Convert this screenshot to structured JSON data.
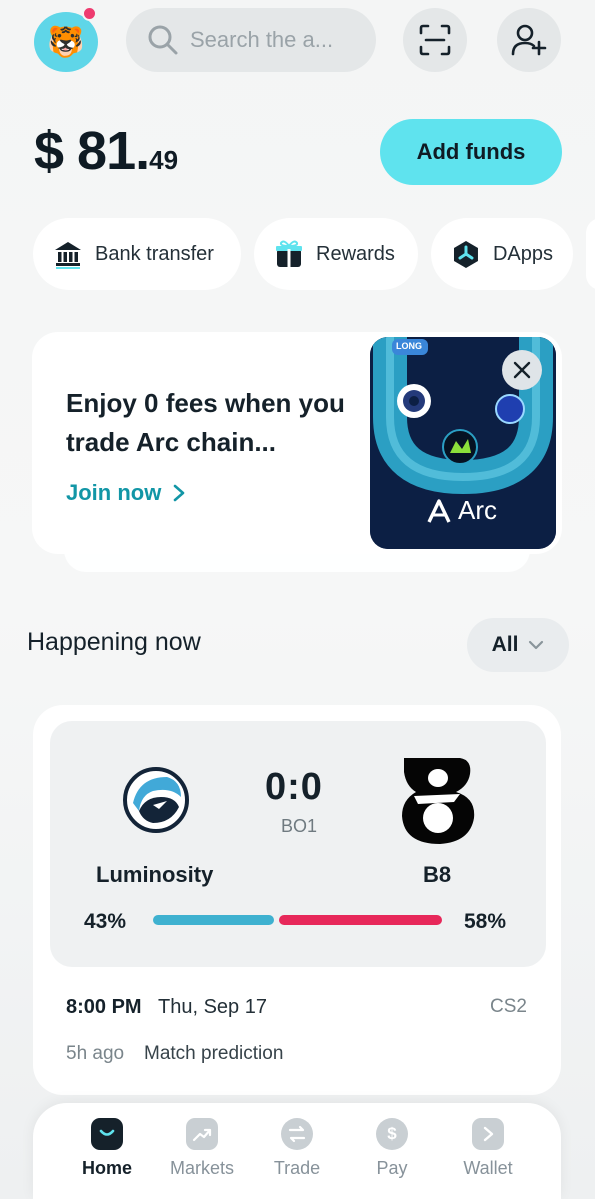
{
  "header": {
    "avatar_emoji": "🐯",
    "search_placeholder": "Search the a...",
    "scan_icon": "scan-icon",
    "add_contact_icon": "add-user-icon"
  },
  "balance": {
    "main": "$ 81.",
    "cents": "49"
  },
  "add_funds_label": "Add funds",
  "quick_actions": [
    {
      "label": "Bank transfer",
      "icon": "bank-icon"
    },
    {
      "label": "Rewards",
      "icon": "gift-icon"
    },
    {
      "label": "DApps",
      "icon": "dapps-icon"
    }
  ],
  "promo": {
    "title": "Enjoy 0 fees when you trade Arc chain...",
    "link": "Join now",
    "brand": "Arc",
    "badge": "LONG"
  },
  "happening": {
    "title": "Happening now",
    "filter": "All"
  },
  "match": {
    "team_a": "Luminosity",
    "team_b": "B8",
    "score": "0:0",
    "format": "BO1",
    "pct_a": "43%",
    "pct_b": "58%",
    "share_a": 0.43,
    "share_b": 0.58,
    "time": "8:00 PM",
    "date": "Thu, Sep 17",
    "game": "CS2",
    "ago": "5h ago",
    "type": "Match prediction"
  },
  "colors": {
    "accent": "#5fe3ee",
    "link": "#1296a6",
    "team_a_bar": "#3eb1d0",
    "team_b_bar": "#e7285a",
    "notification": "#ee3b6f"
  },
  "nav": [
    {
      "label": "Home",
      "icon": "home-icon",
      "active": true
    },
    {
      "label": "Markets",
      "icon": "markets-icon",
      "active": false
    },
    {
      "label": "Trade",
      "icon": "trade-icon",
      "active": false
    },
    {
      "label": "Pay",
      "icon": "pay-icon",
      "active": false
    },
    {
      "label": "Wallet",
      "icon": "wallet-icon",
      "active": false
    }
  ]
}
